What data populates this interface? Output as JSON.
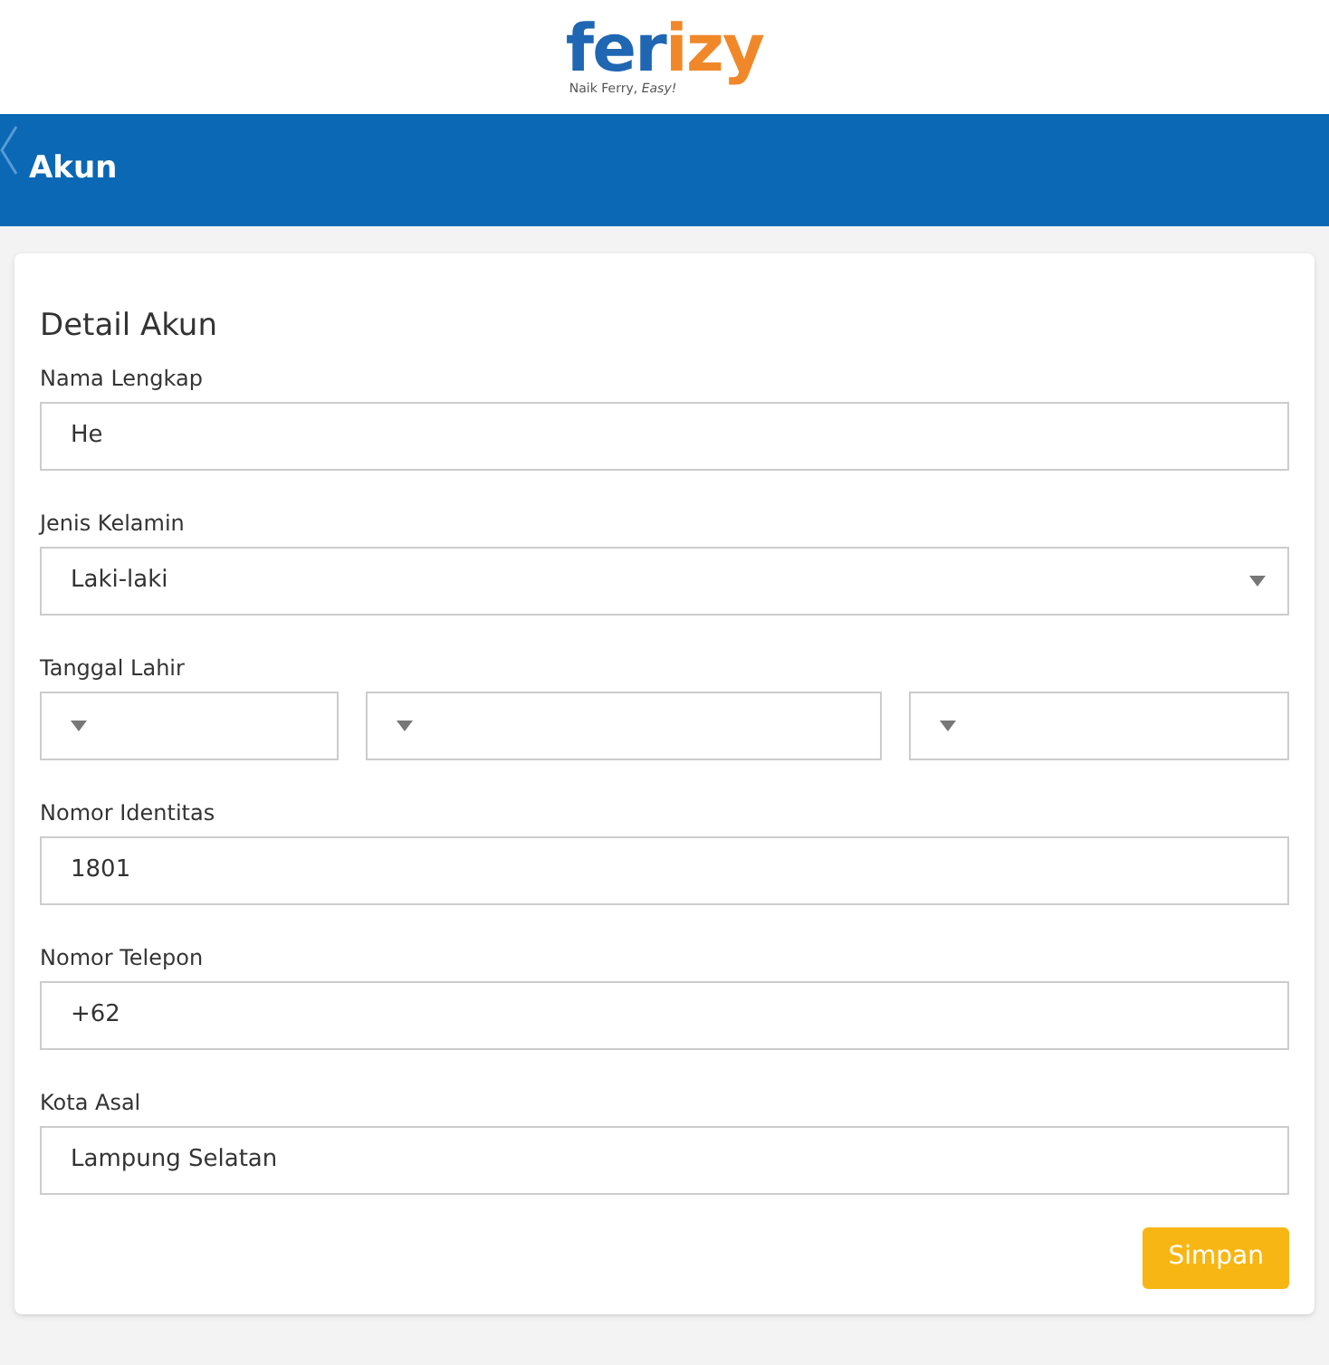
{
  "logo": {
    "parts": [
      {
        "text": "fer",
        "color": "#1f66b3"
      },
      {
        "text": "izy",
        "color": "#f0882a"
      }
    ],
    "tagline": "Naik Ferry, *Easy!*"
  },
  "header": {
    "title": "Akun"
  },
  "form": {
    "title": "Detail Akun",
    "fields": [
      {
        "kind": "text",
        "label": "Nama Lengkap",
        "value": "He"
      },
      {
        "kind": "select",
        "label": "Jenis Kelamin",
        "value": "Laki-laki"
      },
      {
        "kind": "date",
        "label": "Tanggal Lahir"
      },
      {
        "kind": "text",
        "label": "Nomor Identitas",
        "value": "1801"
      },
      {
        "kind": "text",
        "label": "Nomor Telepon",
        "value": "+62"
      },
      {
        "kind": "text",
        "label": "Kota Asal",
        "value": "Lampung Selatan"
      }
    ],
    "submit": "Simpan"
  }
}
